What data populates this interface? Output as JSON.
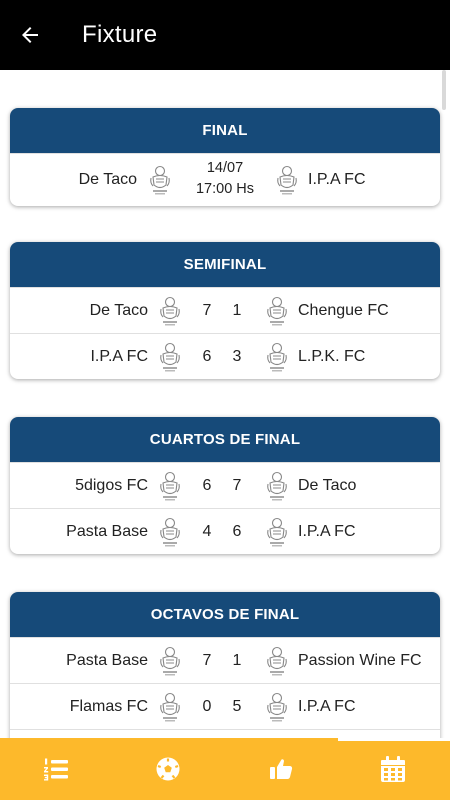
{
  "appbar": {
    "title": "Fixture",
    "back_icon": "arrow-left-icon"
  },
  "colors": {
    "header": "#164a79",
    "accent": "#fdb92b",
    "appbar": "#000000"
  },
  "final": {
    "header": "FINAL",
    "match": {
      "home": "De Taco",
      "date": "14/07",
      "time": "17:00 Hs",
      "away": "I.P.A FC"
    }
  },
  "semifinal": {
    "header": "SEMIFINAL",
    "matches": [
      {
        "home": "De Taco",
        "home_score": "7",
        "away_score": "1",
        "away": "Chengue FC"
      },
      {
        "home": "I.P.A FC",
        "home_score": "6",
        "away_score": "3",
        "away": "L.P.K. FC"
      }
    ]
  },
  "cuartos": {
    "header": "CUARTOS DE FINAL",
    "matches": [
      {
        "home": "5digos FC",
        "home_score": "6",
        "away_score": "7",
        "away": "De Taco"
      },
      {
        "home": "Pasta Base",
        "home_score": "4",
        "away_score": "6",
        "away": "I.P.A FC"
      }
    ]
  },
  "octavos": {
    "header": "OCTAVOS DE FINAL",
    "matches": [
      {
        "home": "Pasta Base",
        "home_score": "7",
        "away_score": "1",
        "away": "Passion Wine FC"
      },
      {
        "home": "Flamas FC",
        "home_score": "0",
        "away_score": "5",
        "away": "I.P.A FC"
      }
    ]
  },
  "bottom_nav": {
    "items": [
      "standings-list-icon",
      "soccer-ball-icon",
      "thumbs-up-icon",
      "calendar-icon"
    ],
    "active": "calendar-icon"
  }
}
